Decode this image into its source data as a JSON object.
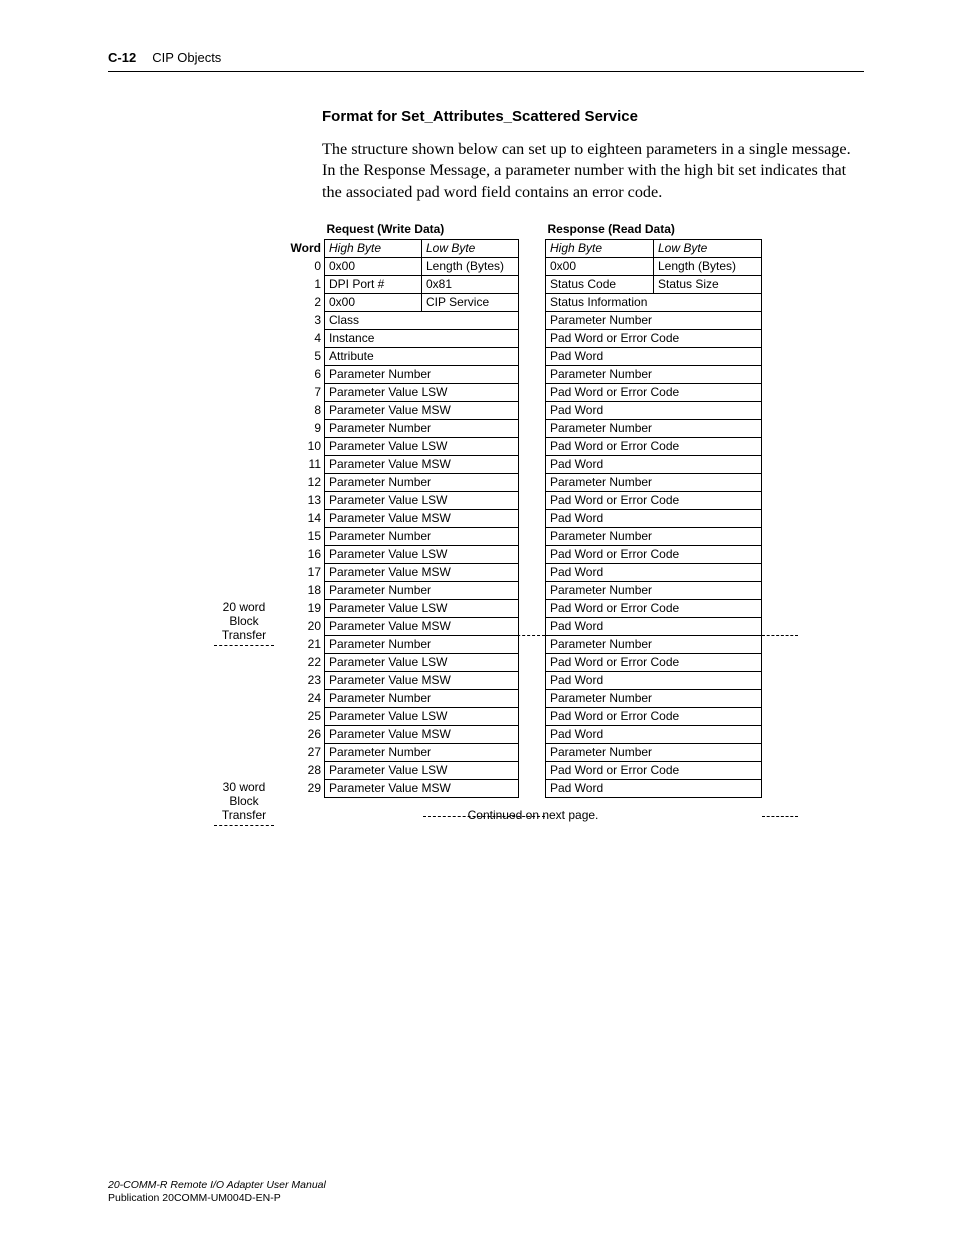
{
  "header": {
    "page": "C-12",
    "chapter": "CIP Objects"
  },
  "section_title": "Format for Set_Attributes_Scattered Service",
  "body": "The structure shown below can set up to eighteen parameters in a single message. In the Response Message, a parameter number with the high bit set indicates that the associated pad word field contains an error code.",
  "continued": "Continued on next page.",
  "word_header": "Word",
  "request": {
    "title": "Request (Write Data)",
    "col_high": "High Byte",
    "col_low": "Low Byte",
    "rows": [
      {
        "w": "0",
        "h": "0x00",
        "l": "Length (Bytes)"
      },
      {
        "w": "1",
        "h": "DPI Port #",
        "l": "0x81"
      },
      {
        "w": "2",
        "h": "0x00",
        "l": "CIP Service"
      },
      {
        "w": "3",
        "span": "Class"
      },
      {
        "w": "4",
        "span": "Instance"
      },
      {
        "w": "5",
        "span": "Attribute"
      },
      {
        "w": "6",
        "span": "Parameter Number"
      },
      {
        "w": "7",
        "span": "Parameter Value LSW"
      },
      {
        "w": "8",
        "span": "Parameter Value MSW"
      },
      {
        "w": "9",
        "span": "Parameter Number"
      },
      {
        "w": "10",
        "span": "Parameter Value LSW"
      },
      {
        "w": "11",
        "span": "Parameter Value MSW"
      },
      {
        "w": "12",
        "span": "Parameter Number"
      },
      {
        "w": "13",
        "span": "Parameter Value LSW"
      },
      {
        "w": "14",
        "span": "Parameter Value MSW"
      },
      {
        "w": "15",
        "span": "Parameter Number"
      },
      {
        "w": "16",
        "span": "Parameter Value LSW"
      },
      {
        "w": "17",
        "span": "Parameter Value MSW"
      },
      {
        "w": "18",
        "span": "Parameter Number"
      },
      {
        "w": "19",
        "span": "Parameter Value LSW"
      },
      {
        "w": "20",
        "span": "Parameter Value MSW"
      },
      {
        "w": "21",
        "span": "Parameter Number"
      },
      {
        "w": "22",
        "span": "Parameter Value LSW"
      },
      {
        "w": "23",
        "span": "Parameter Value MSW"
      },
      {
        "w": "24",
        "span": "Parameter Number"
      },
      {
        "w": "25",
        "span": "Parameter Value LSW"
      },
      {
        "w": "26",
        "span": "Parameter Value MSW"
      },
      {
        "w": "27",
        "span": "Parameter Number"
      },
      {
        "w": "28",
        "span": "Parameter Value LSW"
      },
      {
        "w": "29",
        "span": "Parameter Value MSW"
      }
    ]
  },
  "response": {
    "title": "Response (Read Data)",
    "col_high": "High Byte",
    "col_low": "Low Byte",
    "rows": [
      {
        "h": "0x00",
        "l": "Length (Bytes)"
      },
      {
        "h": "Status Code",
        "l": "Status Size"
      },
      {
        "span": "Status Information"
      },
      {
        "span": "Parameter Number"
      },
      {
        "span": "Pad Word or Error Code"
      },
      {
        "span": "Pad Word"
      },
      {
        "span": "Parameter Number"
      },
      {
        "span": "Pad Word or Error Code"
      },
      {
        "span": "Pad Word"
      },
      {
        "span": "Parameter Number"
      },
      {
        "span": "Pad Word or Error Code"
      },
      {
        "span": "Pad Word"
      },
      {
        "span": "Parameter Number"
      },
      {
        "span": "Pad Word or Error Code"
      },
      {
        "span": "Pad Word"
      },
      {
        "span": "Parameter Number"
      },
      {
        "span": "Pad Word or Error Code"
      },
      {
        "span": "Pad Word"
      },
      {
        "span": "Parameter Number"
      },
      {
        "span": "Pad Word or Error Code"
      },
      {
        "span": "Pad Word"
      },
      {
        "span": "Parameter Number"
      },
      {
        "span": "Pad Word or Error Code"
      },
      {
        "span": "Pad Word"
      },
      {
        "span": "Parameter Number"
      },
      {
        "span": "Pad Word or Error Code"
      },
      {
        "span": "Pad Word"
      },
      {
        "span": "Parameter Number"
      },
      {
        "span": "Pad Word or Error Code"
      },
      {
        "span": "Pad Word"
      }
    ]
  },
  "annot20": "20 word Block Transfer",
  "annot30": "30 word Block Transfer",
  "footer": {
    "title": "20-COMM-R Remote I/O Adapter User Manual",
    "pub": "Publication 20COMM-UM004D-EN-P"
  }
}
